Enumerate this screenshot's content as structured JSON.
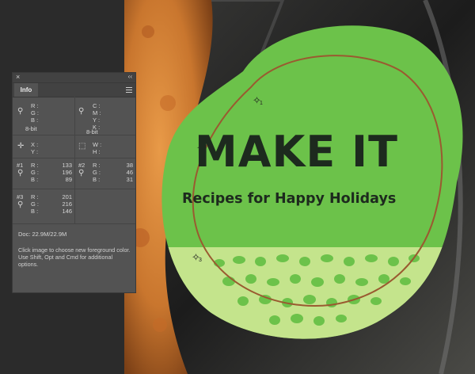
{
  "photo": {
    "headline": "MAKE IT",
    "subtitle": "Recipes for Happy Holidays",
    "samplers": [
      "1",
      "2",
      "3"
    ],
    "colors": {
      "sticker_green": "#6cc24a",
      "sticker_light": "#c4e48c",
      "pizza": "#d88838",
      "dark_bg": "#222222"
    }
  },
  "info_panel": {
    "close_glyph": "×",
    "collapse_glyph": "‹‹",
    "tab_label": "Info",
    "menu_icon": "hamburger-icon",
    "rgb_labels": "R :\nG :\nB :",
    "cmyk_labels": "C :\nM :\nY :\nK :",
    "bit_depth_left": "8-bit",
    "bit_depth_right": "8-bit",
    "xy_labels": "X :\nY :",
    "wh_labels": "W :\nH :",
    "sampler1": {
      "label": "#1",
      "channels": "R :\nG :\nB :",
      "r": "133",
      "g": "196",
      "b": "89"
    },
    "sampler2": {
      "label": "#2",
      "channels": "R :\nG :\nB :",
      "r": "38",
      "g": "46",
      "b": "31"
    },
    "sampler3": {
      "label": "#3",
      "channels": "R :\nG :\nB :",
      "r": "201",
      "g": "216",
      "b": "146"
    },
    "doc": "Doc: 22.9M/22.9M",
    "help_text": "Click image to choose new foreground color.  Use Shift, Opt and Cmd for additional options."
  }
}
